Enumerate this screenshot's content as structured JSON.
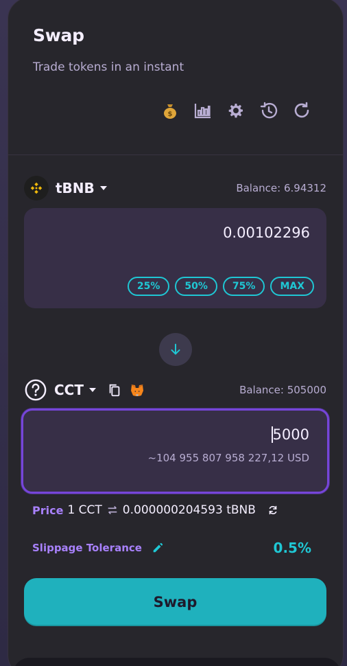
{
  "header": {
    "title": "Swap",
    "subtitle": "Trade tokens in an instant",
    "icons": [
      "money-bag-icon",
      "chart-icon",
      "gear-icon",
      "history-icon",
      "refresh-icon"
    ]
  },
  "from": {
    "token": "tBNB",
    "balance": "Balance: 6.94312",
    "amount": "0.00102296",
    "percent_buttons": [
      "25%",
      "50%",
      "75%",
      "MAX"
    ]
  },
  "to": {
    "token": "CCT",
    "balance": "Balance: 505000",
    "amount": "5000",
    "usd_value": "~104 955 807 958 227,12 USD"
  },
  "price": {
    "label": "Price",
    "value_left": "1 CCT",
    "value_right": "0.000000204593 tBNB"
  },
  "slippage": {
    "label": "Slippage Tolerance",
    "value": "0.5%"
  },
  "swap_button": "Swap",
  "colors": {
    "accent": "#1fc7d4",
    "purple": "#a881fc",
    "card": "#27262c",
    "input": "#372f47"
  }
}
